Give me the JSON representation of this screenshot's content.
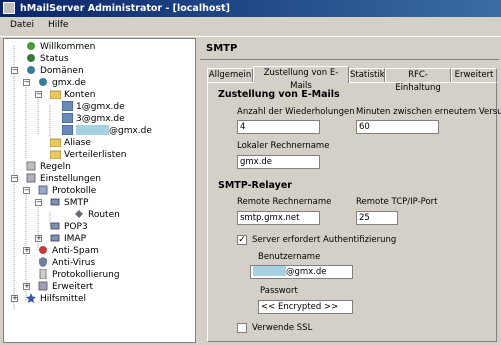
{
  "window": {
    "title": "hMailServer Administrator - [localhost]"
  },
  "menu": {
    "items": [
      "Datei",
      "Hilfe"
    ]
  },
  "tree": {
    "welcome": "Willkommen",
    "status": "Status",
    "domains": "Domänen",
    "domain": "gmx.de",
    "accounts": "Konten",
    "account1": "1@gmx.de",
    "account2": "3@gmx.de",
    "account3_suffix": "@gmx.de",
    "aliases": "Aliase",
    "distlists": "Verteilerlisten",
    "rules": "Regeln",
    "settings": "Einstellungen",
    "protocols": "Protokolle",
    "smtp": "SMTP",
    "routes": "Routen",
    "pop3": "POP3",
    "imap": "IMAP",
    "antispam": "Anti-Spam",
    "antivirus": "Anti-Virus",
    "logging": "Protokollierung",
    "advanced": "Erweitert",
    "tools": "Hilfsmittel"
  },
  "header": {
    "title": "SMTP"
  },
  "tabs": [
    "Allgemein",
    "Zustellung von E-Mails",
    "Statistik",
    "RFC-Einhaltung",
    "Erweitert"
  ],
  "delivery": {
    "title": "Zustellung von E-Mails",
    "retries_label": "Anzahl der Wiederholungen",
    "retries_value": "4",
    "minutes_label": "Minuten zwischen erneutem Versuch",
    "minutes_value": "60",
    "hostname_label": "Lokaler Rechnername",
    "hostname_value": "gmx.de"
  },
  "relayer": {
    "title": "SMTP-Relayer",
    "remote_host_label": "Remote Rechnername",
    "remote_host_value": "smtp.gmx.net",
    "remote_port_label": "Remote TCP/IP-Port",
    "remote_port_value": "25",
    "auth_label": "Server erfordert Authentifizierung",
    "user_label": "Benutzername",
    "user_value_suffix": "@gmx.de",
    "password_label": "Passwort",
    "password_value": "<< Encrypted >>",
    "ssl_label": "Verwende SSL"
  },
  "colors": {
    "title_start": "#0a246a",
    "title_end": "#3a6ea5",
    "redaction": "#a5d1e0"
  }
}
